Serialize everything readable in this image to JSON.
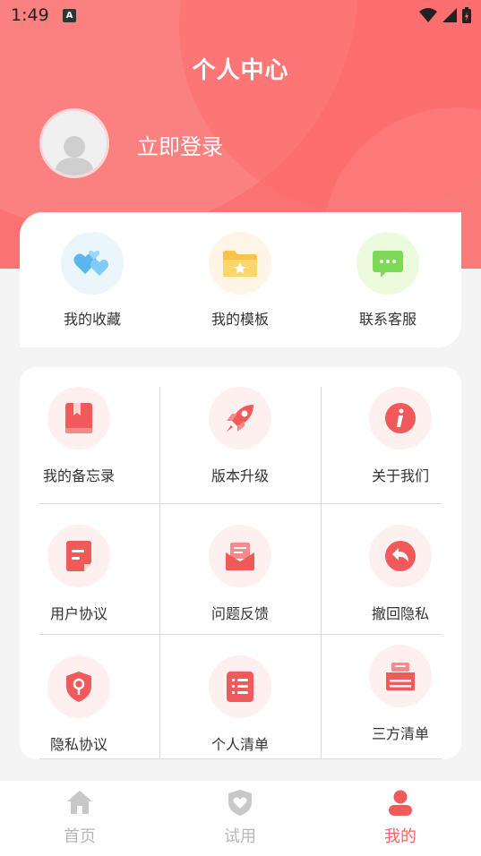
{
  "status_bar": {
    "time": "1:49",
    "notification_icon": "A"
  },
  "header": {
    "title": "个人中心",
    "login_text": "立即登录"
  },
  "quick_actions": [
    {
      "label": "我的收藏",
      "icon": "hearts-icon"
    },
    {
      "label": "我的模板",
      "icon": "star-folder-icon"
    },
    {
      "label": "联系客服",
      "icon": "chat-bubble-icon"
    }
  ],
  "menu": [
    {
      "label": "我的备忘录",
      "icon": "bookmark-icon"
    },
    {
      "label": "版本升级",
      "icon": "rocket-icon"
    },
    {
      "label": "关于我们",
      "icon": "info-icon"
    },
    {
      "label": "用户协议",
      "icon": "document-icon"
    },
    {
      "label": "问题反馈",
      "icon": "mail-icon"
    },
    {
      "label": "撤回隐私",
      "icon": "undo-icon"
    },
    {
      "label": "隐私协议",
      "icon": "shield-icon"
    },
    {
      "label": "个人清单",
      "icon": "list-icon"
    },
    {
      "label": "三方清单",
      "icon": "tray-icon"
    }
  ],
  "tabs": [
    {
      "label": "首页",
      "icon": "home-icon",
      "active": false
    },
    {
      "label": "试用",
      "icon": "heart-shield-icon",
      "active": false
    },
    {
      "label": "我的",
      "icon": "user-icon",
      "active": true
    }
  ],
  "colors": {
    "accent": "#f06565",
    "header_bg": "#fb7272",
    "icon_red": "#f05a5a"
  }
}
